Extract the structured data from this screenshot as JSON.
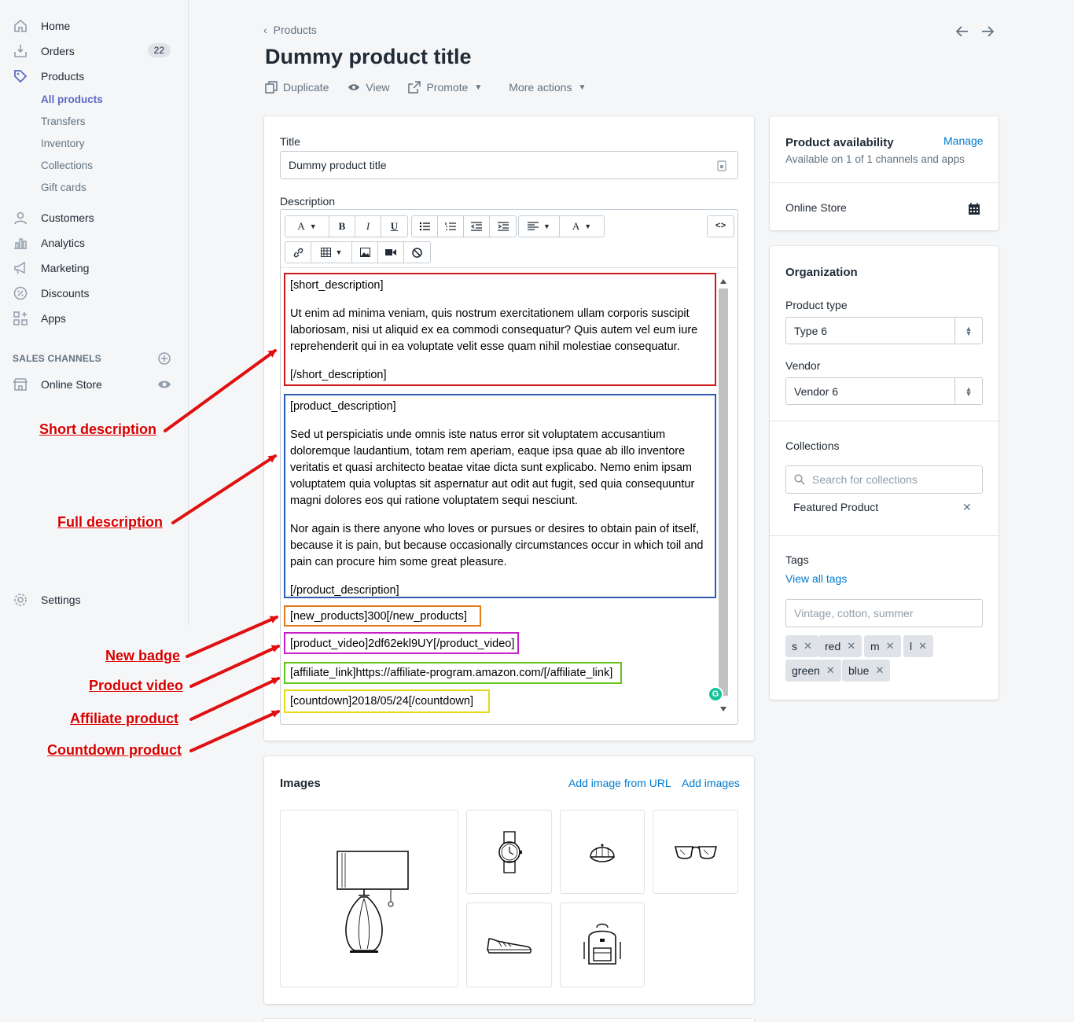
{
  "sidebar": {
    "items": [
      {
        "label": "Home",
        "icon": "home-icon"
      },
      {
        "label": "Orders",
        "icon": "orders-icon",
        "badge": "22"
      },
      {
        "label": "Products",
        "icon": "tag-icon"
      },
      {
        "label": "Customers",
        "icon": "person-icon"
      },
      {
        "label": "Analytics",
        "icon": "bar-chart-icon"
      },
      {
        "label": "Marketing",
        "icon": "megaphone-icon"
      },
      {
        "label": "Discounts",
        "icon": "discount-icon"
      },
      {
        "label": "Apps",
        "icon": "apps-icon"
      }
    ],
    "sub_items": [
      "All products",
      "Transfers",
      "Inventory",
      "Collections",
      "Gift cards"
    ],
    "sales_channels_title": "SALES CHANNELS",
    "online_store": "Online Store",
    "settings": "Settings"
  },
  "annotations": {
    "short": "Short description",
    "full": "Full description",
    "badge": "New badge",
    "video": "Product video",
    "affiliate": "Affiliate product",
    "countdown": "Countdown product"
  },
  "header": {
    "breadcrumb": "Products",
    "title": "Dummy product title",
    "actions": {
      "duplicate": "Duplicate",
      "view": "View",
      "promote": "Promote",
      "more": "More actions"
    }
  },
  "product": {
    "title_label": "Title",
    "title_value": "Dummy product title",
    "description_label": "Description",
    "toolbar_code": "<>",
    "description": {
      "short_open": "[short_description]",
      "short_text": "Ut enim ad minima veniam, quis nostrum exercitationem ullam corporis suscipit laboriosam, nisi ut aliquid ex ea commodi consequatur? Quis autem vel eum iure reprehenderit qui in ea voluptate velit esse quam nihil molestiae consequatur.",
      "short_close": "[/short_description]",
      "full_open": "[product_description]",
      "full_text_1": "Sed ut perspiciatis unde omnis iste natus error sit voluptatem accusantium doloremque laudantium, totam rem aperiam, eaque ipsa quae ab illo inventore veritatis et quasi architecto beatae vitae dicta sunt explicabo. Nemo enim ipsam voluptatem quia voluptas sit aspernatur aut odit aut fugit, sed quia consequuntur magni dolores eos qui ratione voluptatem sequi nesciunt.",
      "full_text_2": "Nor again is there anyone who loves or pursues or desires to obtain pain of itself, because it is pain, but because occasionally circumstances occur in which toil and pain can procure him some great pleasure.",
      "full_close": "[/product_description]",
      "new_products": "[new_products]300[/new_products]",
      "product_video": "[product_video]2df62ekl9UY[/product_video]",
      "affiliate_link": "[affiliate_link]https://affiliate-program.amazon.com/[/affiliate_link]",
      "countdown": "[countdown]2018/05/24[/countdown]"
    },
    "colors": {
      "short": "#d01818",
      "full": "#2a5db0",
      "new_products": "#e07b1a",
      "video": "#c81fc8",
      "affiliate": "#62c41c",
      "countdown": "#e8d81a"
    }
  },
  "images": {
    "title": "Images",
    "add_url": "Add image from URL",
    "add": "Add images",
    "items": [
      "lamp",
      "watch",
      "cap",
      "glasses",
      "sneaker",
      "backpack"
    ]
  },
  "availability": {
    "title": "Product availability",
    "manage": "Manage",
    "subtitle": "Available on 1 of 1 channels and apps",
    "channel": "Online Store"
  },
  "organization": {
    "title": "Organization",
    "type_label": "Product type",
    "type_value": "Type 6",
    "vendor_label": "Vendor",
    "vendor_value": "Vendor 6",
    "collections_label": "Collections",
    "collections_placeholder": "Search for collections",
    "collection_item": "Featured Product",
    "tags_label": "Tags",
    "view_tags": "View all tags",
    "tags_placeholder": "Vintage, cotton, summer",
    "tags": [
      "s",
      "red",
      "m",
      "l",
      "green",
      "blue"
    ]
  }
}
